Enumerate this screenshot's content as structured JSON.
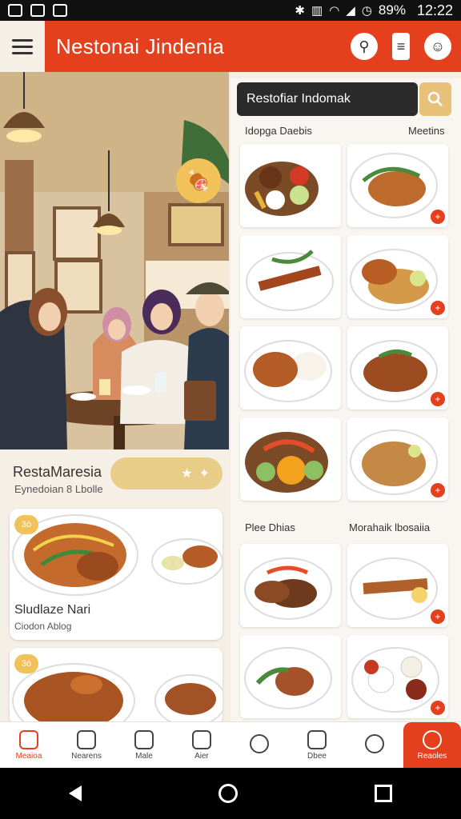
{
  "status_bar": {
    "battery": "89%",
    "time": "12:22"
  },
  "header": {
    "title": "Nestonai Jindenia",
    "menu_icon": "hamburger-icon",
    "icons": [
      "food-search-icon",
      "document-icon",
      "profile-icon"
    ]
  },
  "hero": {
    "badge_icon": "meat-icon"
  },
  "restaurant": {
    "name": "RestaMaresia",
    "subtitle": "Eynedoian 8 Lbolle",
    "star_icons": [
      "star-icon",
      "sparkle-icon"
    ]
  },
  "featured": [
    {
      "tag": "3ò",
      "title": "Sludlaze Nari",
      "subtitle": "Ciodon Ablog"
    },
    {
      "tag": "3ò",
      "title": "",
      "subtitle": ""
    }
  ],
  "search": {
    "placeholder": "Restofiar Indomak",
    "icon": "search-icon"
  },
  "sections": [
    {
      "left": "Idopga Daebis",
      "right": "Meetins"
    },
    {
      "left": "Plee Dhias",
      "right": "Morahaik lbosaiia"
    }
  ],
  "tabs": [
    {
      "label": "Meaioa",
      "icon": "home-icon"
    },
    {
      "label": "Nearens",
      "icon": "notes-icon"
    },
    {
      "label": "Male",
      "icon": "box-icon"
    },
    {
      "label": "Aier",
      "icon": "person-icon"
    },
    {
      "label": "",
      "icon": "plus-badge-icon"
    },
    {
      "label": "Dbee",
      "icon": "menu-grid-icon"
    },
    {
      "label": "",
      "icon": "add-circle-icon"
    },
    {
      "label": "Reaoles",
      "icon": "profile-icon"
    }
  ],
  "colors": {
    "brand": "#e4401e",
    "accent": "#e7c07a",
    "background": "#f3ede4"
  }
}
